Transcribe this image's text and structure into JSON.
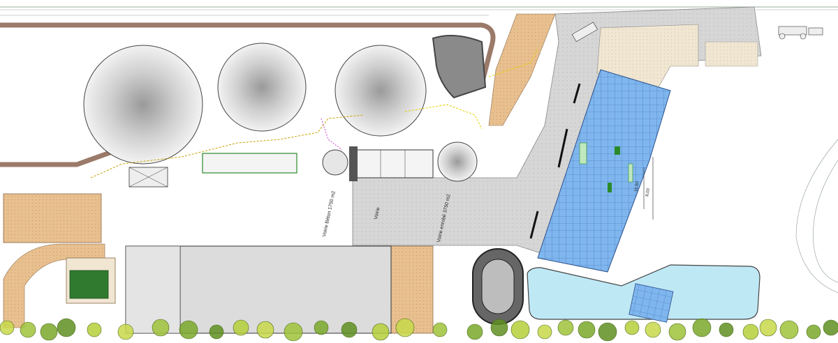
{
  "labels": {
    "voirie_beton": "Voirie Béton 1750 m2",
    "voirie": "Voirie",
    "voirie_enrobe": "Voirie enrobé 3750 m2",
    "dim_right_a": "11,50",
    "dim_right_b": "8,00",
    "dim_top_a": "",
    "dim_top_b": ""
  },
  "colors": {
    "concrete": "#d6d6d6",
    "sand": "#e8c08f",
    "gravel": "#f0e6d2",
    "roof_blue": "#7fb6ee",
    "water": "#bfe8f5",
    "green_panel": "#2f7a2f",
    "wall_brown": "#9b7a6a"
  }
}
